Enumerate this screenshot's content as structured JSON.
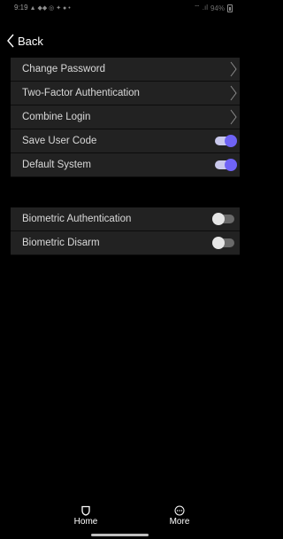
{
  "status_bar": {
    "time": "9:19",
    "notification_icons": "▲ ◆◆ ◎ ✦ ● •",
    "signal": "⌔ .ıl",
    "battery": "94%"
  },
  "header": {
    "back_label": "Back"
  },
  "settings": {
    "items": [
      {
        "label": "Change Password",
        "control": "chevron"
      },
      {
        "label": "Two-Factor Authentication",
        "control": "chevron"
      },
      {
        "label": "Combine Login",
        "control": "chevron"
      },
      {
        "label": "Save User Code",
        "control": "toggle",
        "on": true
      },
      {
        "label": "Default System",
        "control": "toggle",
        "on": true
      }
    ],
    "biometric_items": [
      {
        "label": "Biometric Authentication",
        "control": "toggle",
        "on": false
      },
      {
        "label": "Biometric Disarm",
        "control": "toggle",
        "on": false
      }
    ]
  },
  "bottom_nav": {
    "home_label": "Home",
    "home_icon": "shield-icon",
    "more_label": "More",
    "more_icon": "more-circle-icon"
  },
  "colors": {
    "background": "#000000",
    "row_background": "#222222",
    "toggle_on_knob": "#6f63f5",
    "toggle_on_track": "#c9c8ec",
    "toggle_off_track": "#6a6a6a"
  }
}
